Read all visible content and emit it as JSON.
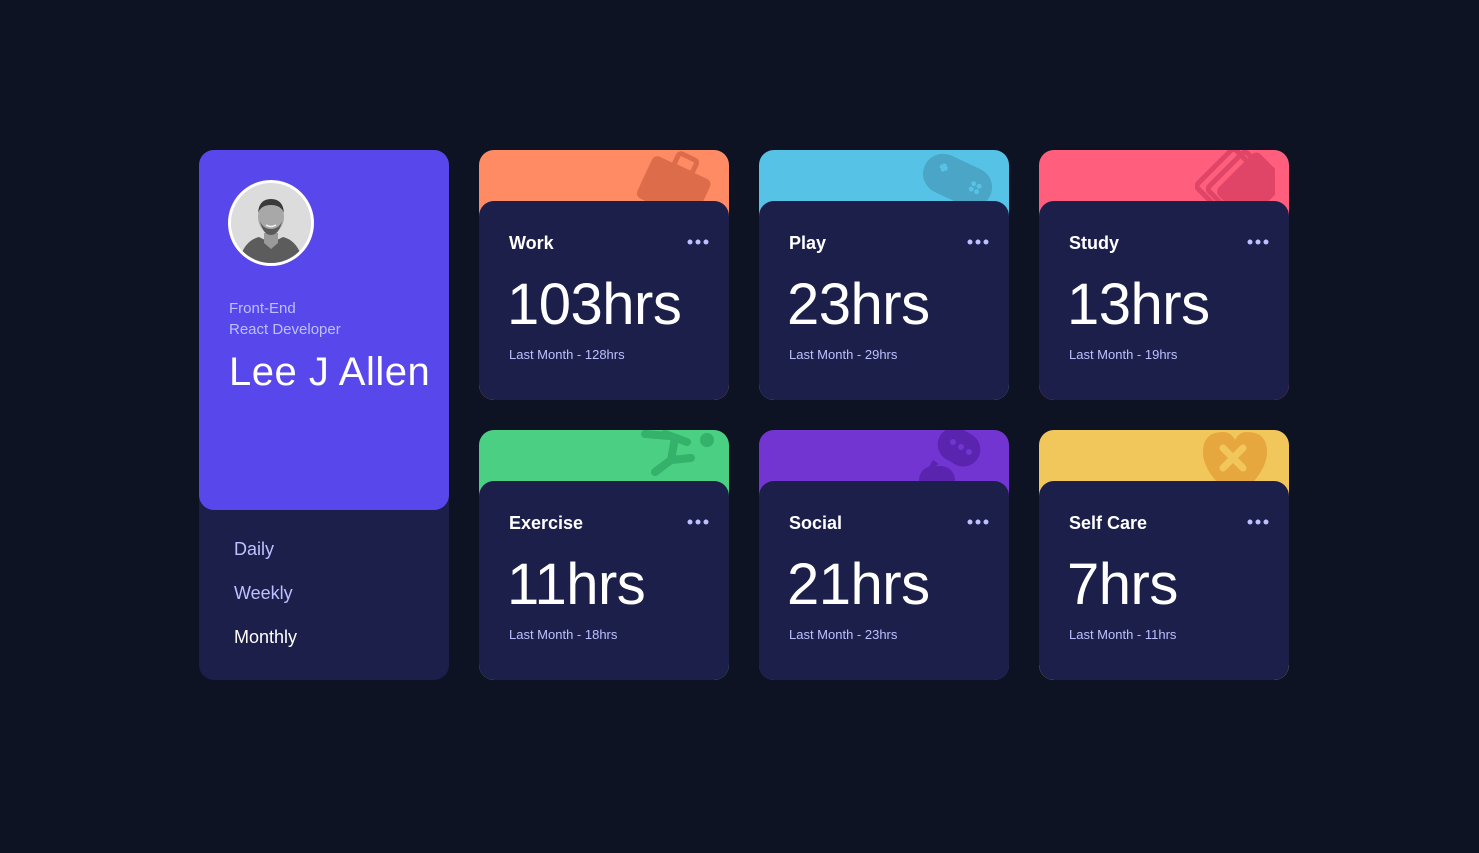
{
  "profile": {
    "report_line_1": "Front-End",
    "report_line_2": "React Developer",
    "name": "Lee J Allen"
  },
  "timeframes": [
    {
      "label": "Daily",
      "active": false
    },
    {
      "label": "Weekly",
      "active": false
    },
    {
      "label": "Monthly",
      "active": true
    }
  ],
  "activities": [
    {
      "title": "Work",
      "current": "103hrs",
      "previous": "Last Month - 128hrs",
      "color": "#ff8b64",
      "icon": "briefcase-icon"
    },
    {
      "title": "Play",
      "current": "23hrs",
      "previous": "Last Month - 29hrs",
      "color": "#55c2e6",
      "icon": "gamepad-icon"
    },
    {
      "title": "Study",
      "current": "13hrs",
      "previous": "Last Month - 19hrs",
      "color": "#ff5e7d",
      "icon": "books-icon"
    },
    {
      "title": "Exercise",
      "current": "11hrs",
      "previous": "Last Month - 18hrs",
      "color": "#4bcf82",
      "icon": "running-icon"
    },
    {
      "title": "Social",
      "current": "21hrs",
      "previous": "Last Month - 23hrs",
      "color": "#7335d2",
      "icon": "chat-bubbles-icon"
    },
    {
      "title": "Self Care",
      "current": "7hrs",
      "previous": "Last Month - 11hrs",
      "color": "#f1c75b",
      "icon": "heart-bandage-icon"
    }
  ],
  "colors": {
    "background": "#0e1323",
    "card": "#1c1f4a",
    "profile_accent": "#5847eb",
    "muted_text": "#bbc0ff"
  }
}
